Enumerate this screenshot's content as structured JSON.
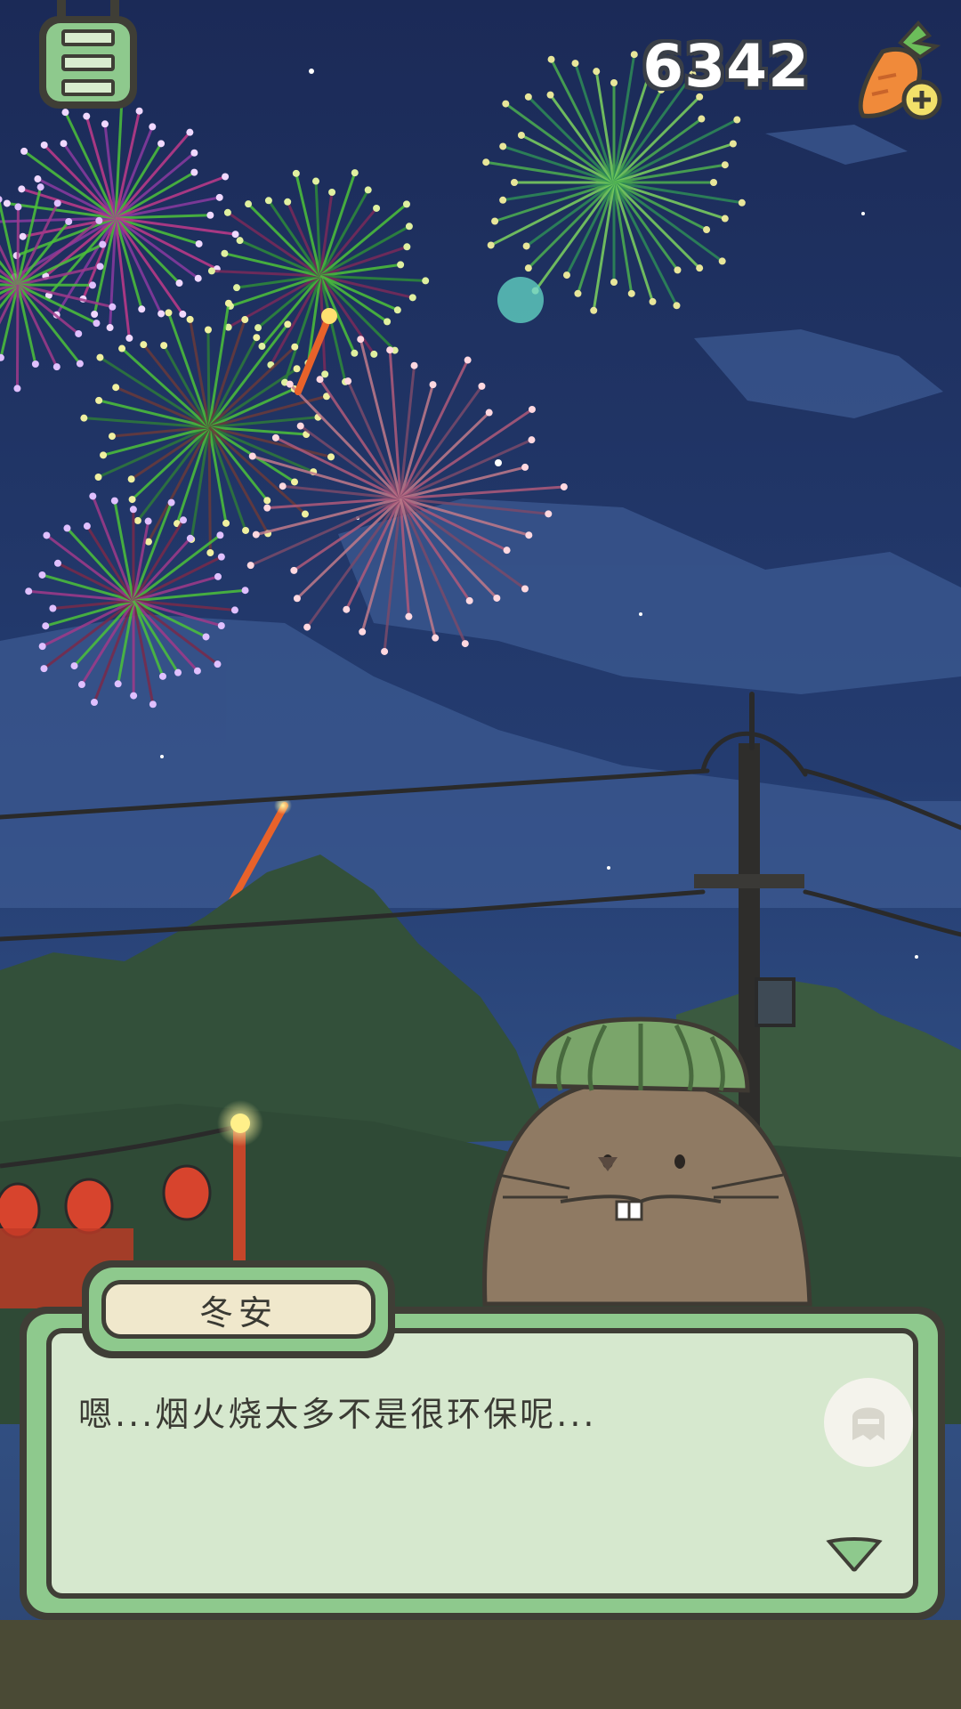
{
  "hud": {
    "carrot_count": "6342",
    "menu_icon": "menu-icon",
    "carrot_icon": "carrot-plus-icon"
  },
  "dialog": {
    "speaker": "冬安",
    "text": "嗯...烟火烧太多不是很环保呢...",
    "skip_icon": "ghost-icon",
    "next_icon": "triangle-down-icon"
  },
  "scene": {
    "setting": "night-fireworks",
    "colors": {
      "sky_top": "#1b2b58",
      "sky_bottom": "#3a5a8c",
      "trees": "#3e5a3e",
      "dialog_green": "#8ec98d",
      "outline": "#3f3e36"
    }
  }
}
